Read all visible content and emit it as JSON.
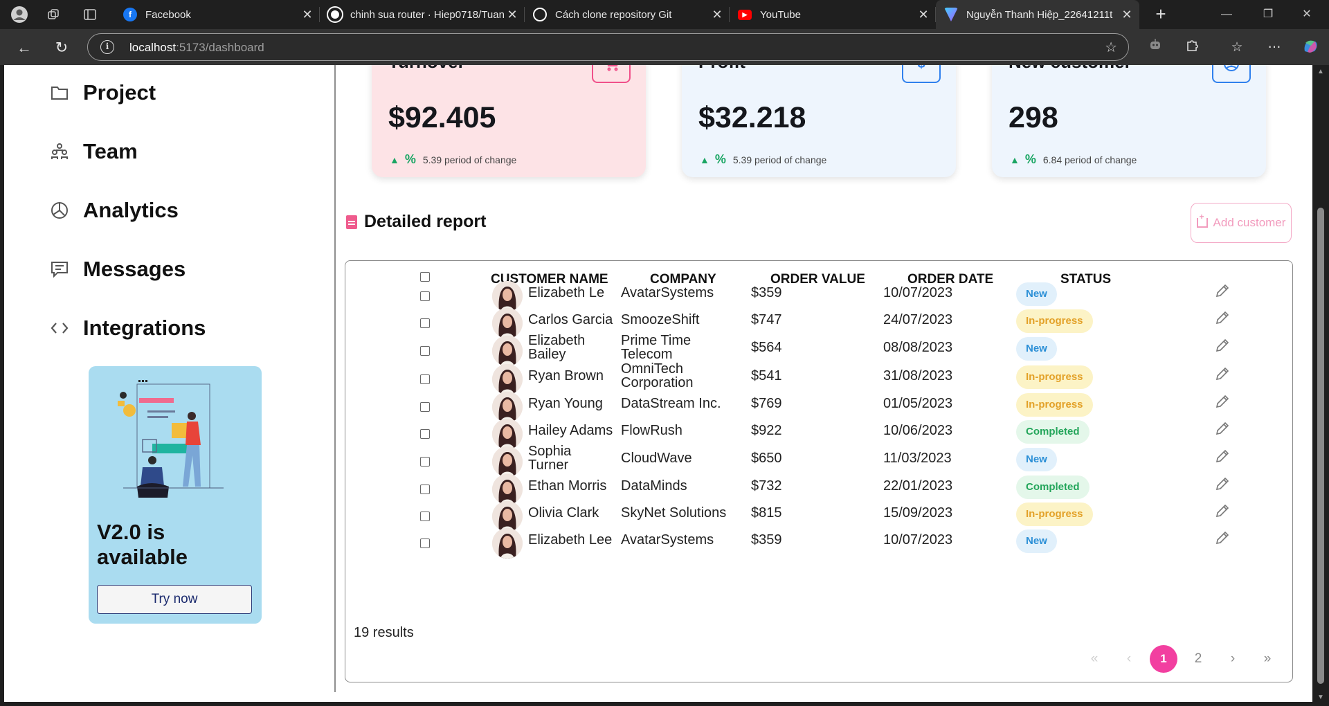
{
  "browser": {
    "tabs": [
      {
        "title": "Facebook",
        "icon": "facebook-icon",
        "color": "#1877f2"
      },
      {
        "title": "chinh sua router · Hiep0718/Tuan",
        "icon": "github-icon",
        "color": "#ffffff"
      },
      {
        "title": "Cách clone repository Git",
        "icon": "chatgpt-icon",
        "color": "#ffffff"
      },
      {
        "title": "YouTube",
        "icon": "youtube-icon",
        "color": "#ff0000"
      },
      {
        "title": "Nguyễn Thanh Hiệp_22641211t",
        "icon": "vite-icon",
        "color": "#a259ff",
        "active": true
      }
    ],
    "url_host": "localhost",
    "url_path": ":5173/dashboard"
  },
  "sidebar": {
    "items": [
      {
        "label": "Project",
        "icon": "folder-icon"
      },
      {
        "label": "Team",
        "icon": "team-icon"
      },
      {
        "label": "Analytics",
        "icon": "pie-chart-icon"
      },
      {
        "label": "Messages",
        "icon": "message-icon"
      },
      {
        "label": "Integrations",
        "icon": "code-icon"
      }
    ],
    "promo": {
      "title": "V2.0 is available",
      "button": "Try now"
    }
  },
  "cards": [
    {
      "title": "Turnover",
      "value": "$92.405",
      "pct": "%",
      "change": "5.39 period of change",
      "bg": "#fde3e6",
      "accent": "#f0508a",
      "icon": "cart-icon"
    },
    {
      "title": "Profit",
      "value": "$32.218",
      "pct": "%",
      "change": "5.39 period of change",
      "bg": "#eef5fd",
      "accent": "#2f80ed",
      "icon": "dollar-icon"
    },
    {
      "title": "New customer",
      "value": "298",
      "pct": "%",
      "change": "6.84 period of change",
      "bg": "#eef5fd",
      "accent": "#2f80ed",
      "icon": "user-icon"
    }
  ],
  "report": {
    "title": "Detailed report",
    "add_button": "Add customer",
    "columns": [
      "CUSTOMER NAME",
      "COMPANY",
      "ORDER VALUE",
      "ORDER DATE",
      "STATUS"
    ],
    "rows": [
      {
        "name": [
          "Elizabeth Le"
        ],
        "company": [
          "AvatarSystems"
        ],
        "value": "$359",
        "date": "10/07/2023",
        "status": "New"
      },
      {
        "name": [
          "Carlos Garcia"
        ],
        "company": [
          "SmoozeShift"
        ],
        "value": "$747",
        "date": "24/07/2023",
        "status": "In-progress"
      },
      {
        "name": [
          "Elizabeth",
          "Bailey"
        ],
        "company": [
          "Prime Time",
          "Telecom"
        ],
        "value": "$564",
        "date": "08/08/2023",
        "status": "New"
      },
      {
        "name": [
          "Ryan Brown"
        ],
        "company": [
          "OmniTech",
          "Corporation"
        ],
        "value": "$541",
        "date": "31/08/2023",
        "status": "In-progress"
      },
      {
        "name": [
          "Ryan Young"
        ],
        "company": [
          "DataStream Inc."
        ],
        "value": "$769",
        "date": "01/05/2023",
        "status": "In-progress"
      },
      {
        "name": [
          "Hailey Adams"
        ],
        "company": [
          "FlowRush"
        ],
        "value": "$922",
        "date": "10/06/2023",
        "status": "Completed"
      },
      {
        "name": [
          "Sophia",
          "Turner"
        ],
        "company": [
          "CloudWave"
        ],
        "value": "$650",
        "date": "11/03/2023",
        "status": "New"
      },
      {
        "name": [
          "Ethan Morris"
        ],
        "company": [
          "DataMinds"
        ],
        "value": "$732",
        "date": "22/01/2023",
        "status": "Completed"
      },
      {
        "name": [
          "Olivia Clark"
        ],
        "company": [
          "SkyNet Solutions"
        ],
        "value": "$815",
        "date": "15/09/2023",
        "status": "In-progress"
      },
      {
        "name": [
          "Elizabeth Lee"
        ],
        "company": [
          "AvatarSystems"
        ],
        "value": "$359",
        "date": "10/07/2023",
        "status": "New"
      }
    ],
    "results": "19 results",
    "pagination": {
      "first": "«",
      "prev": "‹",
      "pages": [
        "1",
        "2"
      ],
      "current": "1",
      "next": "›",
      "last": "»"
    }
  }
}
